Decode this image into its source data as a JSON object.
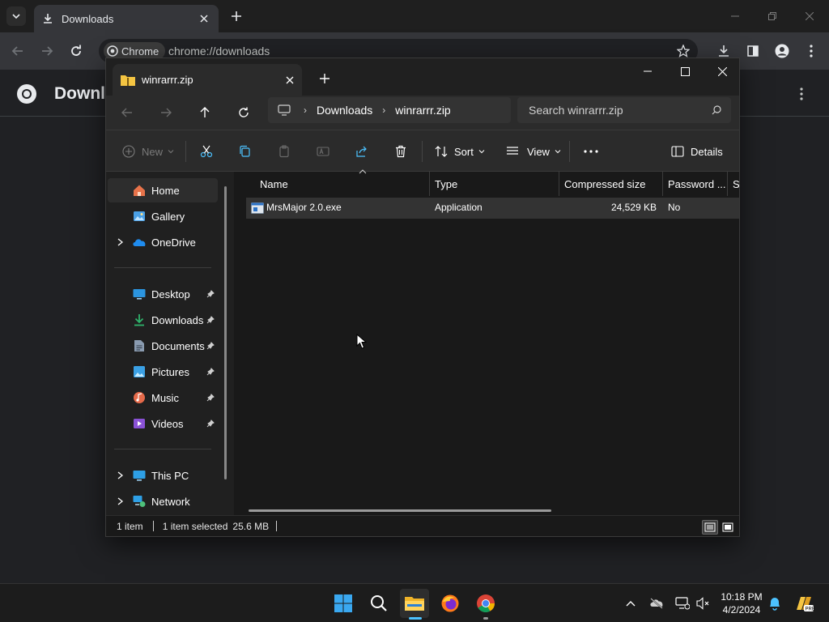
{
  "chrome": {
    "tab_title": "Downloads",
    "omnibox_chip": "Chrome",
    "url": "chrome://downloads",
    "page_title": "Downloads"
  },
  "explorer": {
    "tab_title": "winrarrr.zip",
    "breadcrumbs": [
      "Downloads",
      "winrarrr.zip"
    ],
    "search_placeholder": "Search winrarrr.zip",
    "commands": {
      "new": "New",
      "sort": "Sort",
      "view": "View",
      "details": "Details"
    },
    "nav_items": [
      {
        "label": "Home",
        "icon": "home-icon"
      },
      {
        "label": "Gallery",
        "icon": "gallery-icon"
      },
      {
        "label": "OneDrive",
        "icon": "onedrive-icon"
      },
      {
        "label": "Desktop",
        "icon": "desktop-icon"
      },
      {
        "label": "Downloads",
        "icon": "downloads-icon"
      },
      {
        "label": "Documents",
        "icon": "documents-icon"
      },
      {
        "label": "Pictures",
        "icon": "pictures-icon"
      },
      {
        "label": "Music",
        "icon": "music-icon"
      },
      {
        "label": "Videos",
        "icon": "videos-icon"
      },
      {
        "label": "This PC",
        "icon": "this-pc-icon"
      },
      {
        "label": "Network",
        "icon": "network-icon"
      }
    ],
    "columns": [
      "Name",
      "Type",
      "Compressed size",
      "Password ...",
      "Si"
    ],
    "files": [
      {
        "name": "MrsMajor 2.0.exe",
        "type": "Application",
        "compressed_size": "24,529 KB",
        "password": "No"
      }
    ],
    "status": {
      "count": "1 item",
      "selected": "1 item selected",
      "size": "25.6 MB"
    }
  },
  "taskbar": {
    "time": "10:18 PM",
    "date": "4/2/2024"
  },
  "colors": {
    "accent_blue": "#4cc2ff",
    "folder_yellow": "#f5c542"
  }
}
